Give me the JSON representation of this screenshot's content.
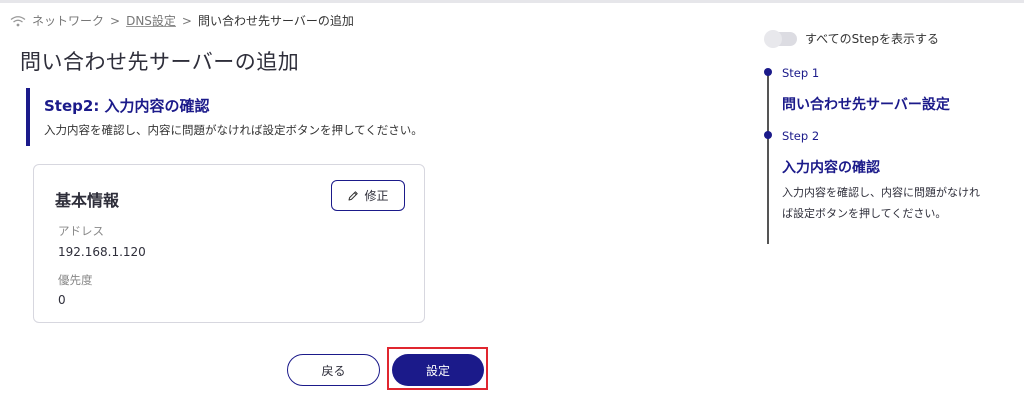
{
  "breadcrumb": {
    "items": [
      "ネットワーク",
      "DNS設定",
      "問い合わせ先サーバーの追加"
    ],
    "separator": ">"
  },
  "page": {
    "title": "問い合わせ先サーバーの追加"
  },
  "step_header": {
    "title": "Step2: 入力内容の確認",
    "description": "入力内容を確認し、内容に問題がなければ設定ボタンを押してください。"
  },
  "card": {
    "title": "基本情報",
    "edit_label": "修正",
    "fields": [
      {
        "label": "アドレス",
        "value": "192.168.1.120"
      },
      {
        "label": "優先度",
        "value": "0"
      }
    ]
  },
  "actions": {
    "back_label": "戻る",
    "set_label": "設定"
  },
  "stepper": {
    "toggle_label": "すべてのStepを表示する",
    "steps": [
      {
        "number": "Step 1",
        "name": "問い合わせ先サーバー設定"
      },
      {
        "number": "Step 2",
        "name": "入力内容の確認",
        "note": "入力内容を確認し、内容に問題がなければ設定ボタンを押してください。"
      }
    ]
  },
  "colors": {
    "accent": "#1b1a8a",
    "highlight": "#e0262f"
  }
}
